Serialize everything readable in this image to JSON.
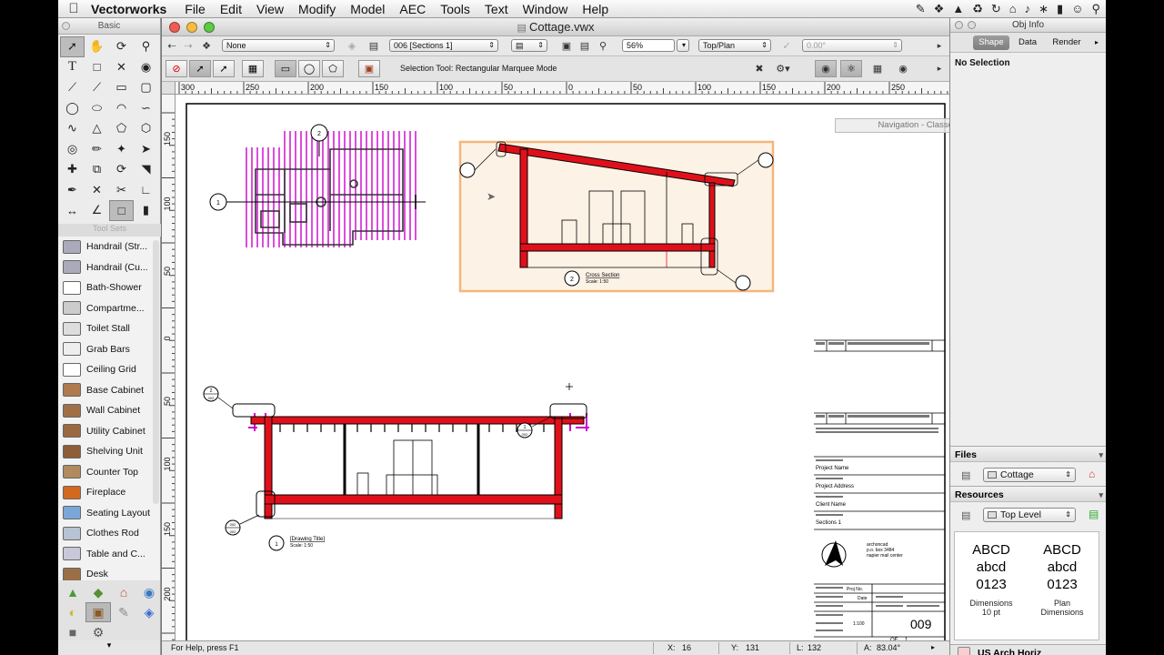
{
  "menubar": {
    "app_name": "Vectorworks",
    "menus": [
      "File",
      "Edit",
      "View",
      "Modify",
      "Model",
      "AEC",
      "Tools",
      "Text",
      "Window",
      "Help"
    ]
  },
  "basic_palette": {
    "title": "Basic"
  },
  "tool_sets_label": "Tool Sets",
  "toolset_items": [
    "Handrail (Str...",
    "Handrail (Cu...",
    "Bath-Shower",
    "Compartme...",
    "Toilet Stall",
    "Grab Bars",
    "Ceiling Grid",
    "Base Cabinet",
    "Wall Cabinet",
    "Utility Cabinet",
    "Shelving Unit",
    "Counter Top",
    "Fireplace",
    "Seating Layout",
    "Clothes Rod",
    "Table and C...",
    "Desk"
  ],
  "document": {
    "title": "Cottage.vwx",
    "class_select": "None",
    "layer_select": "006 [Sections 1]",
    "zoom": "56%",
    "view": "Top/Plan",
    "rotation": "0.00°",
    "mode_text": "Selection Tool: Rectangular Marquee Mode",
    "nav_palette": "Navigation - Classes"
  },
  "ruler": {
    "h_ticks": [
      "300",
      "250",
      "200",
      "150",
      "100",
      "50",
      "0",
      "50",
      "100",
      "150",
      "200",
      "250"
    ],
    "v_ticks": [
      "150",
      "100",
      "50",
      "0",
      "50",
      "100",
      "150",
      "200"
    ]
  },
  "drawing": {
    "cross_section_label": "Cross Section",
    "cross_section_scale": "Scale: 1:50",
    "drawing_title_label": "[Drawing Title]",
    "drawing_title_scale": "Scale: 1:50",
    "marker_2": "2",
    "marker_1": "1",
    "marker_002": "002",
    "titleblock": {
      "project_name": "Project Name",
      "project_address": "Project Address",
      "client_name": "Client Name",
      "sections": "Sections 1",
      "company": [
        "archoncad",
        "p.o. box 3484",
        "napier mail center"
      ],
      "proj_no": "Proj No.",
      "date": "Date",
      "scale": "1:100",
      "sheet_number": "009",
      "of": "OF",
      "of_count": "1"
    }
  },
  "statusbar": {
    "help": "For Help, press F1",
    "x_label": "X:",
    "x": "16",
    "y_label": "Y:",
    "y": "131",
    "l_label": "L:",
    "l": "132",
    "a_label": "A:",
    "a": "83.04°"
  },
  "obj_info": {
    "title": "Obj Info",
    "tabs": [
      "Shape",
      "Data",
      "Render"
    ],
    "selection": "No Selection",
    "files_label": "Files",
    "files_value": "Cottage",
    "resources_label": "Resources",
    "resources_value": "Top Level",
    "res_items": [
      {
        "lines": [
          "ABCD",
          "abcd",
          "0123"
        ],
        "caption": [
          "Dimensions",
          "10 pt"
        ]
      },
      {
        "lines": [
          "ABCD",
          "abcd",
          "0123"
        ],
        "caption": [
          "Plan",
          "Dimensions"
        ]
      }
    ],
    "footer": "US Arch Horiz"
  },
  "colors": {
    "wall_red": "#e0101a",
    "selection_orange": "#f3b77c",
    "grid_magenta": "#cc00cc"
  }
}
